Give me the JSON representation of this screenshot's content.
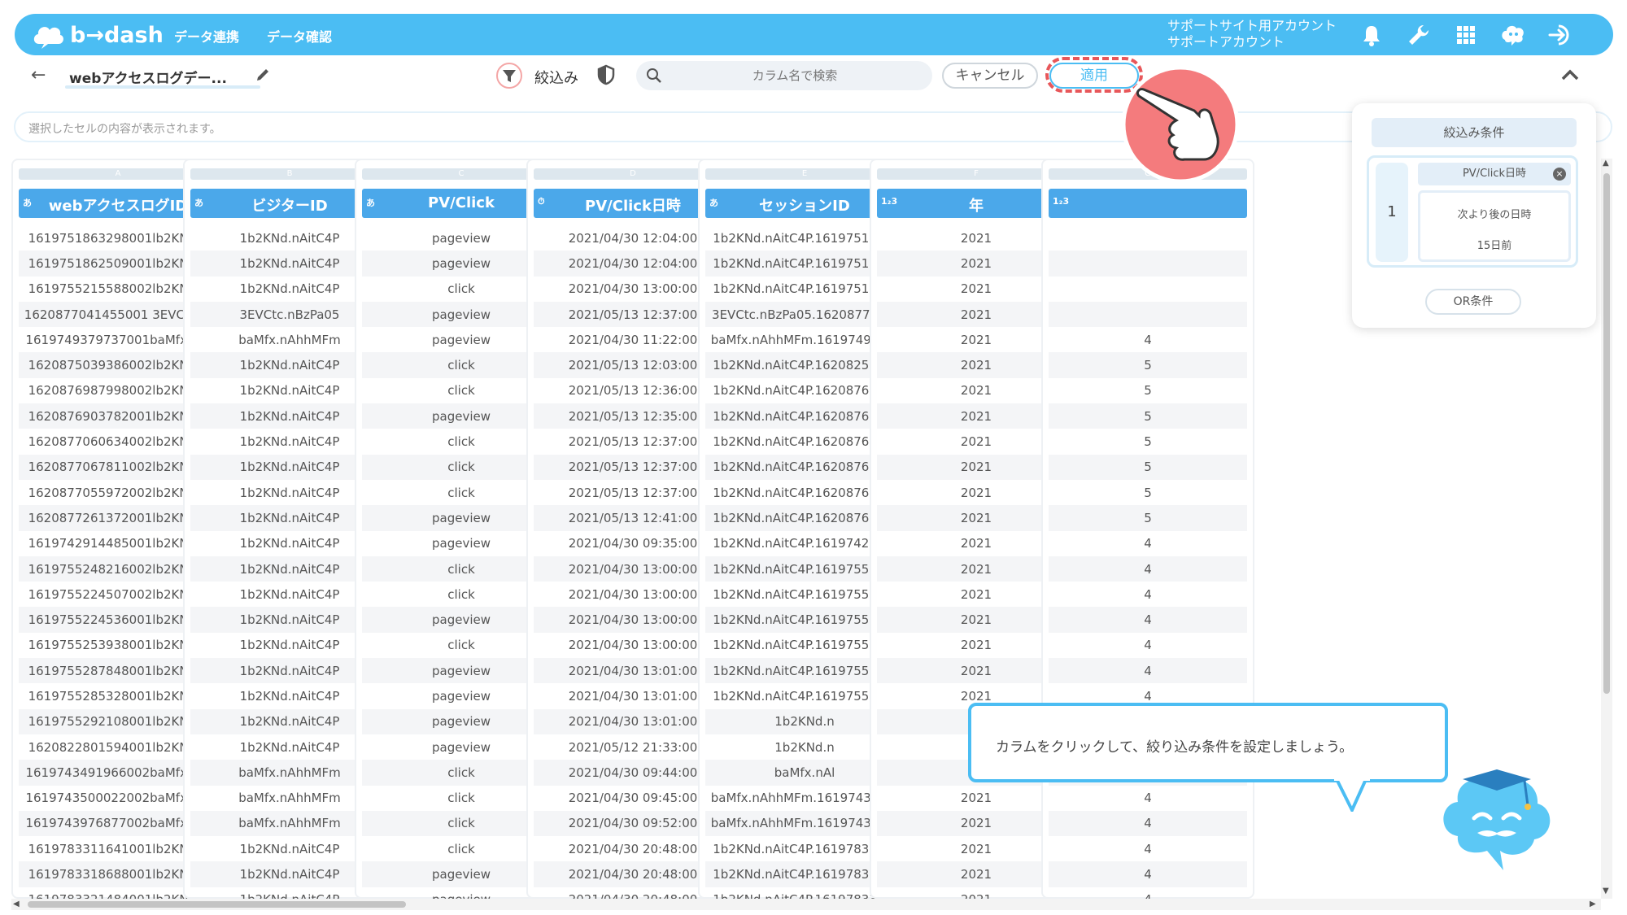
{
  "header": {
    "logo_text": "b→dash",
    "nav": [
      "データ連携",
      "データ確認"
    ],
    "account_line1": "サポートサイト用アカウント",
    "account_line2": "サポートアカウント"
  },
  "toolbar": {
    "sheet_title": "webアクセスログデー...",
    "filter_label": "絞込み",
    "search_placeholder": "カラム名で検索",
    "cancel_label": "キャンセル",
    "apply_label": "適用"
  },
  "cellbar": {
    "placeholder": "選択したセルの内容が表示されます。"
  },
  "columns": [
    {
      "letter": "A",
      "type": "あ",
      "name": "webアクセスログID",
      "cells": [
        "1619751863298001lb2KNd...",
        "1619751862509001lb2KNd...",
        "1619755215588002lb2KNd...",
        "1620877041455001 3EVCtc....",
        "1619749379737001baMfx.n...",
        "1620875039386002lb2KNd...",
        "1620876987998002lb2KNd...",
        "1620876903782001lb2KNd...",
        "1620877060634002lb2KNd...",
        "1620877067811002lb2KNd...",
        "1620877055972002lb2KNd...",
        "1620877261372001lb2KNd...",
        "1619742914485001lb2KNd...",
        "1619755248216002lb2KNd...",
        "1619755224507002lb2KNd...",
        "1619755224536001lb2KNd...",
        "1619755253938001lb2KNd...",
        "1619755287848001lb2KNd...",
        "1619755285328001lb2KNd...",
        "1619755292108001lb2KNd...",
        "1620822801594001lb2KNd...",
        "1619743491966002baMfx.n...",
        "1619743500022002baMfx.n...",
        "1619743976877002baMfx.n...",
        "1619783311641001lb2KNd...",
        "1619783318688001lb2KNd...",
        "1619783321484001lb2KNd..."
      ]
    },
    {
      "letter": "B",
      "type": "あ",
      "name": "ビジターID",
      "cells": [
        "1b2KNd.nAitC4P",
        "1b2KNd.nAitC4P",
        "1b2KNd.nAitC4P",
        "3EVCtc.nBzPa05",
        "baMfx.nAhhMFm",
        "1b2KNd.nAitC4P",
        "1b2KNd.nAitC4P",
        "1b2KNd.nAitC4P",
        "1b2KNd.nAitC4P",
        "1b2KNd.nAitC4P",
        "1b2KNd.nAitC4P",
        "1b2KNd.nAitC4P",
        "1b2KNd.nAitC4P",
        "1b2KNd.nAitC4P",
        "1b2KNd.nAitC4P",
        "1b2KNd.nAitC4P",
        "1b2KNd.nAitC4P",
        "1b2KNd.nAitC4P",
        "1b2KNd.nAitC4P",
        "1b2KNd.nAitC4P",
        "1b2KNd.nAitC4P",
        "baMfx.nAhhMFm",
        "baMfx.nAhhMFm",
        "baMfx.nAhhMFm",
        "1b2KNd.nAitC4P",
        "1b2KNd.nAitC4P",
        "1b2KNd.nAitC4P"
      ]
    },
    {
      "letter": "C",
      "type": "あ",
      "name": "PV/Click",
      "cells": [
        "pageview",
        "pageview",
        "click",
        "pageview",
        "pageview",
        "click",
        "click",
        "pageview",
        "click",
        "click",
        "click",
        "pageview",
        "pageview",
        "click",
        "click",
        "pageview",
        "click",
        "pageview",
        "pageview",
        "pageview",
        "pageview",
        "click",
        "click",
        "click",
        "click",
        "pageview",
        "pageview"
      ]
    },
    {
      "letter": "D",
      "type": "⏱",
      "name": "PV/Click日時",
      "cells": [
        "2021/04/30 12:04:00",
        "2021/04/30 12:04:00",
        "2021/04/30 13:00:00",
        "2021/05/13 12:37:00",
        "2021/04/30 11:22:00",
        "2021/05/13 12:03:00",
        "2021/05/13 12:36:00",
        "2021/05/13 12:35:00",
        "2021/05/13 12:37:00",
        "2021/05/13 12:37:00",
        "2021/05/13 12:37:00",
        "2021/05/13 12:41:00",
        "2021/04/30 09:35:00",
        "2021/04/30 13:00:00",
        "2021/04/30 13:00:00",
        "2021/04/30 13:00:00",
        "2021/04/30 13:00:00",
        "2021/04/30 13:01:00",
        "2021/04/30 13:01:00",
        "2021/04/30 13:01:00",
        "2021/05/12 21:33:00",
        "2021/04/30 09:44:00",
        "2021/04/30 09:45:00",
        "2021/04/30 09:52:00",
        "2021/04/30 20:48:00",
        "2021/04/30 20:48:00",
        "2021/04/30 20:48:00"
      ]
    },
    {
      "letter": "E",
      "type": "あ",
      "name": "セッションID",
      "cells": [
        "1b2KNd.nAitC4P.161975180...",
        "1b2KNd.nAitC4P.161975180...",
        "1b2KNd.nAitC4P.161975180...",
        "3EVCtc.nBzPa05.162087702...",
        "baMfx.nAhhMFm.161974929...",
        "1b2KNd.nAitC4P.162082526...",
        "1b2KNd.nAitC4P.162087690...",
        "1b2KNd.nAitC4P.162087690...",
        "1b2KNd.nAitC4P.162087690...",
        "1b2KNd.nAitC4P.162087690...",
        "1b2KNd.nAitC4P.162087690...",
        "1b2KNd.nAitC4P.162087690...",
        "1b2KNd.nAitC4P.161974291...",
        "1b2KNd.nAitC4P.161975521...",
        "1b2KNd.nAitC4P.161975521...",
        "1b2KNd.nAitC4P.161975521...",
        "1b2KNd.nAitC4P.161975521...",
        "1b2KNd.nAitC4P.161975521...",
        "1b2KNd.nAitC4P.161975521...",
        "1b2KNd.n",
        "1b2KNd.n",
        "baMfx.nAl",
        "baMfx.nAhhMFm.161974348...",
        "baMfx.nAhhMFm.161974348...",
        "1b2KNd.nAitC4P.161978330...",
        "1b2KNd.nAitC4P.161978330...",
        "1b2KNd.nAitC4P.161978330..."
      ]
    },
    {
      "letter": "F",
      "type": "1₂3",
      "name": "年",
      "cells": [
        "2021",
        "2021",
        "2021",
        "2021",
        "2021",
        "2021",
        "2021",
        "2021",
        "2021",
        "2021",
        "2021",
        "2021",
        "2021",
        "2021",
        "2021",
        "2021",
        "2021",
        "2021",
        "2021",
        "",
        "",
        "",
        "2021",
        "2021",
        "2021",
        "2021",
        "2021"
      ]
    },
    {
      "letter": "G",
      "type": "1₂3",
      "name": "",
      "cells": [
        "",
        "",
        "",
        "",
        "4",
        "5",
        "5",
        "5",
        "5",
        "5",
        "5",
        "5",
        "4",
        "4",
        "4",
        "4",
        "4",
        "4",
        "4",
        "",
        "",
        "",
        "4",
        "4",
        "4",
        "4",
        "4"
      ]
    }
  ],
  "filter_panel": {
    "title": "絞込み条件",
    "group_number": "1",
    "chip_label": "PV/Click日時",
    "condition_line1": "次より後の日時",
    "condition_line2": "15日前",
    "or_label": "OR条件"
  },
  "tooltip": {
    "text": "カラムをクリックして、絞り込み条件を設定しましょう。"
  },
  "colors": {
    "brand": "#4bbdf3",
    "header": "#4ba8ea",
    "highlight": "#e8575a"
  }
}
